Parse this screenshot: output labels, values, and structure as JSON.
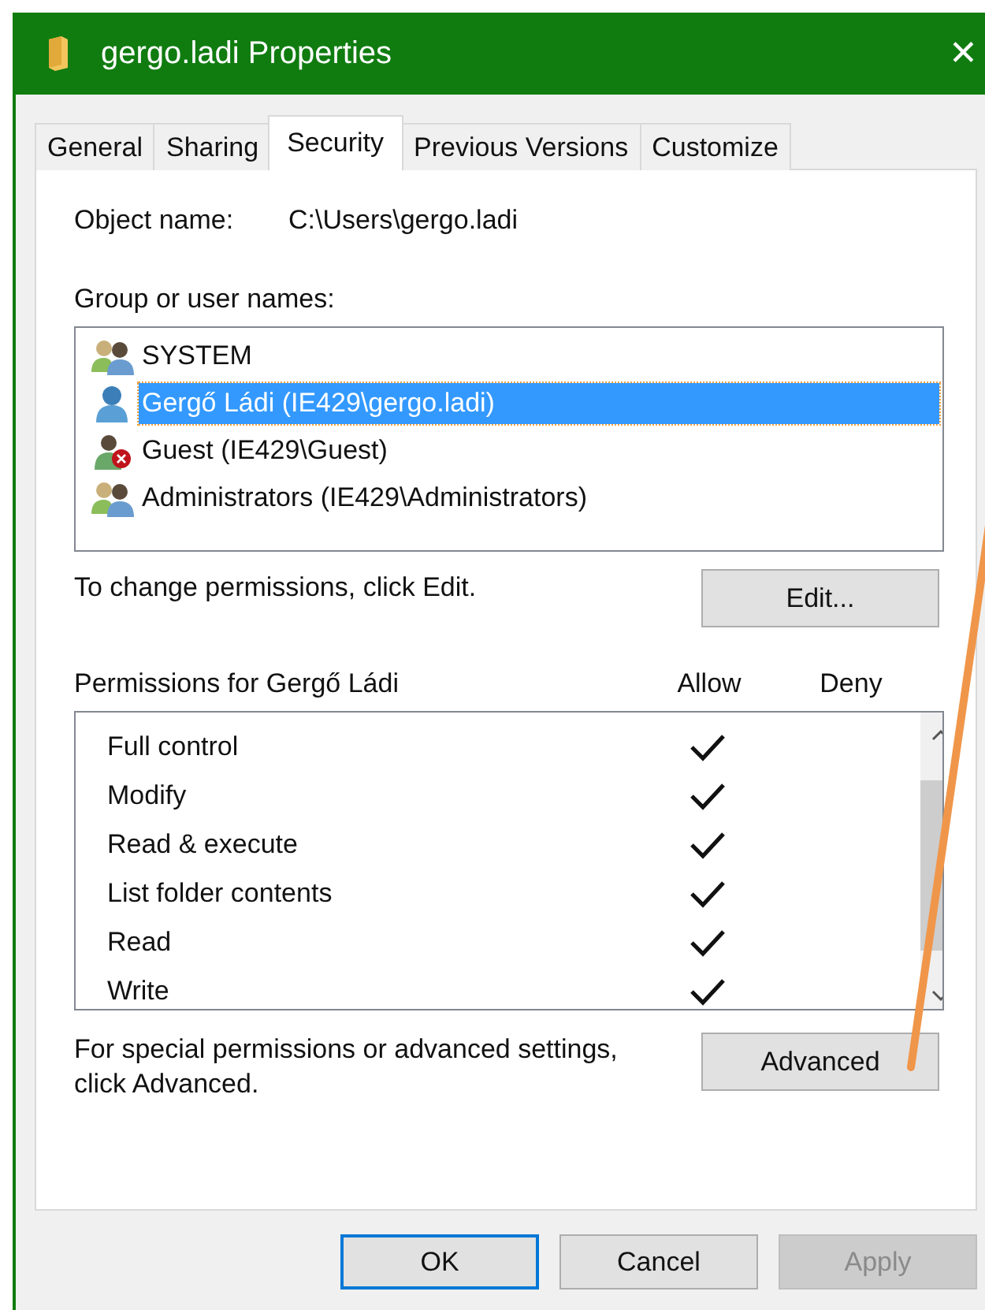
{
  "window": {
    "title": "gergo.ladi Properties",
    "close": "✕"
  },
  "tabs": [
    {
      "label": "General",
      "selected": false
    },
    {
      "label": "Sharing",
      "selected": false
    },
    {
      "label": "Security",
      "selected": true
    },
    {
      "label": "Previous Versions",
      "selected": false
    },
    {
      "label": "Customize",
      "selected": false
    }
  ],
  "object_name": {
    "label": "Object name:",
    "value": "C:\\Users\\gergo.ladi"
  },
  "users": {
    "label": "Group or user names:",
    "items": [
      {
        "name": "SYSTEM",
        "kind": "group",
        "selected": false
      },
      {
        "name": "Gergő Ládi (IE429\\gergo.ladi)",
        "kind": "user",
        "selected": true
      },
      {
        "name": "Guest (IE429\\Guest)",
        "kind": "guest",
        "selected": false
      },
      {
        "name": "Administrators (IE429\\Administrators)",
        "kind": "group",
        "selected": false
      }
    ]
  },
  "edit_hint": "To change permissions, click Edit.",
  "edit_button": "Edit...",
  "permissions": {
    "title": "Permissions for Gergő Ládi",
    "allow_label": "Allow",
    "deny_label": "Deny",
    "items": [
      {
        "name": "Full control",
        "allow": true,
        "deny": false
      },
      {
        "name": "Modify",
        "allow": true,
        "deny": false
      },
      {
        "name": "Read & execute",
        "allow": true,
        "deny": false
      },
      {
        "name": "List folder contents",
        "allow": true,
        "deny": false
      },
      {
        "name": "Read",
        "allow": true,
        "deny": false
      },
      {
        "name": "Write",
        "allow": true,
        "deny": false
      }
    ]
  },
  "advanced_hint": "For special permissions or advanced settings, click Advanced.",
  "advanced_button": "Advanced",
  "buttons": [
    {
      "label": "OK",
      "default": true,
      "disabled": false
    },
    {
      "label": "Cancel",
      "default": false,
      "disabled": false
    },
    {
      "label": "Apply",
      "default": false,
      "disabled": true
    }
  ]
}
